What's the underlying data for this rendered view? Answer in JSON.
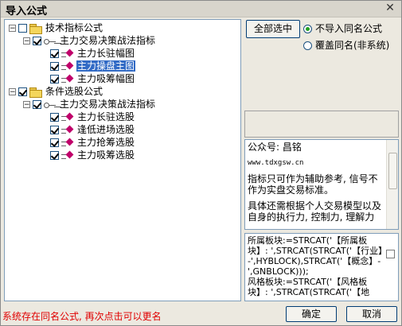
{
  "window": {
    "title": "导入公式",
    "close_glyph": "✕"
  },
  "tree": [
    {
      "label": "技术指标公式",
      "checked": false,
      "icon": "folder-icon",
      "expander": "−"
    },
    {
      "label": "主力交易决策战法指标",
      "checked": true,
      "icon": "key-icon",
      "expander": "−"
    },
    {
      "label": "主力长驻幅图",
      "checked": true,
      "icon": "formula-icon",
      "selected": false
    },
    {
      "label": "主力操盘主图",
      "checked": true,
      "icon": "formula-icon",
      "selected": true
    },
    {
      "label": "主力吸筹幅图",
      "checked": true,
      "icon": "formula-icon",
      "selected": false
    },
    {
      "label": "条件选股公式",
      "checked": true,
      "icon": "folder-icon",
      "expander": "−"
    },
    {
      "label": "主力交易决策战法指标",
      "checked": true,
      "icon": "key-icon",
      "expander": "−"
    },
    {
      "label": "主力长驻选股",
      "checked": true,
      "icon": "formula-icon",
      "selected": false
    },
    {
      "label": "逢低进场选股",
      "checked": true,
      "icon": "formula-icon",
      "selected": false
    },
    {
      "label": "主力抢筹选股",
      "checked": true,
      "icon": "formula-icon",
      "selected": false
    },
    {
      "label": "主力吸筹选股",
      "checked": true,
      "icon": "formula-icon",
      "selected": false
    }
  ],
  "options": {
    "select_all_label": "全部选中",
    "radio_no_import": "不导入同名公式",
    "radio_overwrite": "覆盖同名(非系统)",
    "selected_radio": "no_import"
  },
  "description": {
    "line1": "公众号: 昌铭",
    "line2": "www.tdxgsw.cn",
    "line3": "指标只可作为辅助参考, 信号不作为实盘交易标准。",
    "line4": "具体还需根据个人交易模型以及自身的执行力, 控制力, 理解力"
  },
  "code": {
    "text": "所属板块:=STRCAT('【所属板块】: ',STRCAT(STRCAT('【行业】-',HYBLOCK),STRCAT('【概念】-',GNBLOCK)));\n风格板块:=STRCAT('【风格板块】: ',STRCAT(STRCAT('【地"
  },
  "status_text": "系统存在同名公式, 再次点击可以更名",
  "buttons": {
    "ok": "确定",
    "cancel": "取消"
  },
  "colors": {
    "selection": "#316ac5",
    "status_text": "#e00000",
    "formula_icon": "#c0006a"
  }
}
